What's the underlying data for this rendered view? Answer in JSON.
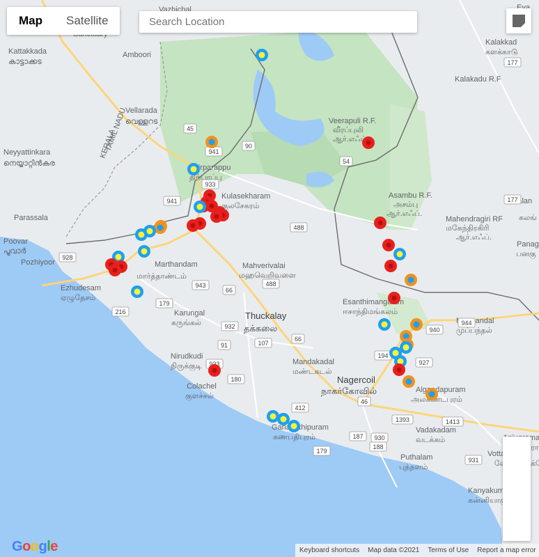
{
  "map_type": {
    "map_label": "Map",
    "satellite_label": "Satellite"
  },
  "search": {
    "placeholder": "Search Location",
    "value": ""
  },
  "footer": {
    "keyboard": "Keyboard shortcuts",
    "map_data": "Map data ©2021",
    "terms": "Terms of Use",
    "report": "Report a map error"
  },
  "logo": {
    "letters": [
      "G",
      "o",
      "o",
      "g",
      "l",
      "e"
    ],
    "colors": [
      "#4285F4",
      "#EA4335",
      "#FBBC05",
      "#4285F4",
      "#34A853",
      "#EA4335"
    ]
  },
  "colors": {
    "water": "#9ecaf6",
    "land": "#e9ecee",
    "park": "#c5e4c2",
    "major_road": "#fcd57a",
    "red": "#e8201d",
    "orange": "#f39219",
    "blue": "#1e9ff2",
    "yellow": "#f6f23a"
  },
  "places": [
    {
      "name": "Vazhichal",
      "style": "small"
    },
    {
      "name": "Sanctuary",
      "style": "park"
    },
    {
      "name": "Kattakkada",
      "style": "small"
    },
    {
      "name": "കാട്ടാക്കട",
      "style": "small"
    },
    {
      "name": "Amboori",
      "style": "small"
    },
    {
      "name": "Vellarada",
      "style": "small"
    },
    {
      "name": "വെള്ളറട",
      "style": "small"
    },
    {
      "name": "Neyyattinkara",
      "style": "medium"
    },
    {
      "name": "നെയ്യാറ്റിൻകര",
      "style": "medium"
    },
    {
      "name": "Parassala",
      "style": "small"
    },
    {
      "name": "Poovar",
      "style": "small"
    },
    {
      "name": "പൂവാർ",
      "style": "small"
    },
    {
      "name": "Pozhiyoor",
      "style": "small"
    },
    {
      "name": "Marthandam",
      "style": "medium"
    },
    {
      "name": "மார்த்தாண்டம்",
      "style": "medium"
    },
    {
      "name": "Ezhudesam",
      "style": "small"
    },
    {
      "name": "ஏழுதேசம்",
      "style": "small"
    },
    {
      "name": "Karungal",
      "style": "small"
    },
    {
      "name": "கருங்கல்",
      "style": "small"
    },
    {
      "name": "Nirudkudi",
      "style": "small"
    },
    {
      "name": "நிருக்குடி",
      "style": "small"
    },
    {
      "name": "Colachel",
      "style": "small"
    },
    {
      "name": "குளச்சல்",
      "style": "small"
    },
    {
      "name": "Thuckalay",
      "style": "big"
    },
    {
      "name": "தக்கலை",
      "style": "big"
    },
    {
      "name": "Mahverivalai",
      "style": "small"
    },
    {
      "name": "மஹவெறிவளை",
      "style": "small"
    },
    {
      "name": "Kulasekharam",
      "style": "medium"
    },
    {
      "name": "குலசேகரம்",
      "style": "medium"
    },
    {
      "name": "Thirparappu",
      "style": "small"
    },
    {
      "name": "திற்பரப்பு",
      "style": "small"
    },
    {
      "name": "Mandakadal",
      "style": "small"
    },
    {
      "name": "மண்டகடல்",
      "style": "small"
    },
    {
      "name": "Nagercoil",
      "style": "big"
    },
    {
      "name": "நாகர்கோவில்",
      "style": "big"
    },
    {
      "name": "Ganapathipuram",
      "style": "small"
    },
    {
      "name": "கணபதிபுரம்",
      "style": "small"
    },
    {
      "name": "Veerapuli R.F.",
      "style": "small"
    },
    {
      "name": "வீரப்புலி",
      "style": "small"
    },
    {
      "name": "ஆர்.எஃப்.",
      "style": "small"
    },
    {
      "name": "Asambu R.F.",
      "style": "small"
    },
    {
      "name": "அசம்பு",
      "style": "small"
    },
    {
      "name": "ஆர்.எஃப்.",
      "style": "small"
    },
    {
      "name": "Mahendragiri RF",
      "style": "small"
    },
    {
      "name": "மகேந்திரகிரி",
      "style": "small"
    },
    {
      "name": "ஆர்.எஃப்.",
      "style": "small"
    },
    {
      "name": "Kalakkad",
      "style": "small"
    },
    {
      "name": "களக்காடு",
      "style": "small"
    },
    {
      "name": "Kalakadu R.F",
      "style": "small"
    },
    {
      "name": "Esanthimangalam",
      "style": "small"
    },
    {
      "name": "ஈசாந்திமங்கலம்",
      "style": "small"
    },
    {
      "name": "Algandapuram",
      "style": "small"
    },
    {
      "name": "அலகண்டபுரம்",
      "style": "small"
    },
    {
      "name": "Vadakadam",
      "style": "small"
    },
    {
      "name": "வடக்கம்",
      "style": "small"
    },
    {
      "name": "Puthalam",
      "style": "small"
    },
    {
      "name": "புத்தளம்",
      "style": "small"
    },
    {
      "name": "Kanyakumari",
      "style": "small"
    },
    {
      "name": "கன்னியாகுமரி",
      "style": "small"
    },
    {
      "name": "Muppandal",
      "style": "small"
    },
    {
      "name": "முப்பந்தல்",
      "style": "small"
    },
    {
      "name": "Anjugramam",
      "style": "small"
    },
    {
      "name": "அஞ்சுகிராமம்",
      "style": "small"
    },
    {
      "name": "Vottaikottai",
      "style": "small"
    },
    {
      "name": "வோட்டைக்கோட்டை",
      "style": "small"
    },
    {
      "name": "Eva",
      "style": "small"
    },
    {
      "name": "கலங்",
      "style": "small"
    },
    {
      "name": "Kalan",
      "style": "small"
    },
    {
      "name": "Panag",
      "style": "small"
    },
    {
      "name": "பனகு",
      "style": "small"
    },
    {
      "name": "KERALA",
      "style": "state"
    },
    {
      "name": "TAMIL NADU",
      "style": "state"
    }
  ],
  "road_shields": [
    "45",
    "941",
    "90",
    "933",
    "941",
    "54",
    "177",
    "177",
    "488",
    "928",
    "943",
    "66",
    "488",
    "179",
    "216",
    "932",
    "91",
    "107",
    "66",
    "933",
    "180",
    "194",
    "940",
    "944",
    "46",
    "412",
    "187",
    "930",
    "1393",
    "179",
    "188",
    "1413",
    "931",
    "927"
  ],
  "markers": [
    {
      "color": "blue"
    },
    {
      "color": "orange"
    },
    {
      "color": "blue"
    },
    {
      "color": "red"
    },
    {
      "color": "red"
    },
    {
      "color": "red"
    },
    {
      "color": "red"
    },
    {
      "color": "red"
    },
    {
      "color": "red"
    },
    {
      "color": "blue"
    },
    {
      "color": "red"
    },
    {
      "color": "red"
    },
    {
      "color": "red"
    },
    {
      "color": "orange"
    },
    {
      "color": "orange"
    },
    {
      "color": "blue"
    },
    {
      "color": "blue"
    },
    {
      "color": "blue"
    },
    {
      "color": "blue"
    },
    {
      "color": "red"
    },
    {
      "color": "red"
    },
    {
      "color": "red"
    },
    {
      "color": "blue"
    },
    {
      "color": "red"
    },
    {
      "color": "red"
    },
    {
      "color": "red"
    },
    {
      "color": "blue"
    },
    {
      "color": "red"
    },
    {
      "color": "orange"
    },
    {
      "color": "red"
    },
    {
      "color": "blue"
    },
    {
      "color": "orange"
    },
    {
      "color": "orange"
    },
    {
      "color": "orange"
    },
    {
      "color": "blue"
    },
    {
      "color": "blue"
    },
    {
      "color": "blue"
    },
    {
      "color": "red"
    },
    {
      "color": "orange"
    },
    {
      "color": "orange"
    },
    {
      "color": "blue"
    },
    {
      "color": "blue"
    },
    {
      "color": "blue"
    },
    {
      "color": "red"
    }
  ]
}
